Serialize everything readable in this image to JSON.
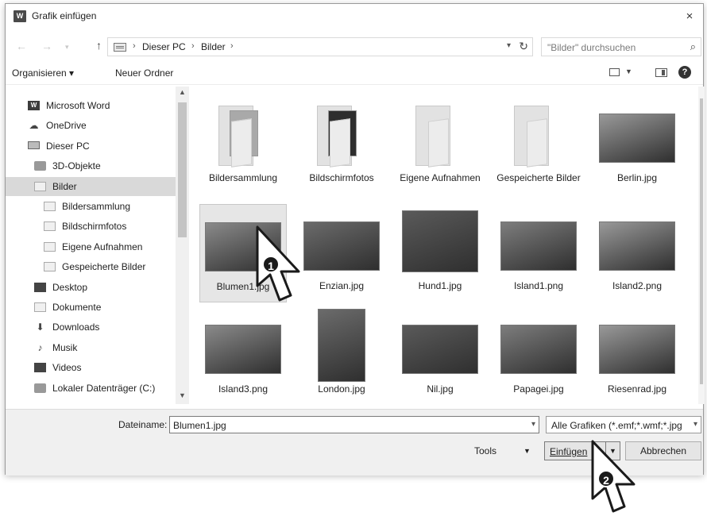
{
  "window": {
    "title": "Grafik einfügen",
    "app_icon_text": "W",
    "close_glyph": "×"
  },
  "nav": {
    "back": "←",
    "forward": "→",
    "up": "↑"
  },
  "address": {
    "crumbs": [
      "Dieser PC",
      "Bilder"
    ],
    "separator": "›"
  },
  "search": {
    "placeholder": "\"Bilder\" durchsuchen",
    "icon": "search-icon"
  },
  "toolbar": {
    "organize": "Organisieren ▾",
    "new_folder": "Neuer Ordner",
    "help": "?"
  },
  "sidebar": {
    "items": [
      {
        "label": "Microsoft Word",
        "icon": "word-icon"
      },
      {
        "label": "OneDrive",
        "icon": "cloud-icon"
      },
      {
        "label": "Dieser PC",
        "icon": "pc-icon"
      },
      {
        "label": "3D-Objekte",
        "icon": "cube-icon"
      },
      {
        "label": "Bilder",
        "icon": "pictures-icon",
        "selected": true
      },
      {
        "label": "Bildersammlung",
        "icon": "folder-icon"
      },
      {
        "label": "Bildschirmfotos",
        "icon": "folder-icon"
      },
      {
        "label": "Eigene Aufnahmen",
        "icon": "folder-icon"
      },
      {
        "label": "Gespeicherte Bilder",
        "icon": "folder-icon"
      },
      {
        "label": "Desktop",
        "icon": "desktop-icon"
      },
      {
        "label": "Dokumente",
        "icon": "document-icon"
      },
      {
        "label": "Downloads",
        "icon": "download-icon"
      },
      {
        "label": "Musik",
        "icon": "music-icon"
      },
      {
        "label": "Videos",
        "icon": "video-icon"
      },
      {
        "label": "Lokaler Datenträger (C:)",
        "icon": "drive-icon"
      }
    ]
  },
  "files": [
    {
      "label": "Bildersammlung",
      "kind": "folder-photos"
    },
    {
      "label": "Bildschirmfotos",
      "kind": "folder-dark"
    },
    {
      "label": "Eigene Aufnahmen",
      "kind": "folder"
    },
    {
      "label": "Gespeicherte Bilder",
      "kind": "folder"
    },
    {
      "label": "Berlin.jpg",
      "kind": "image"
    },
    {
      "label": "Blumen1.jpg",
      "kind": "image",
      "selected": true
    },
    {
      "label": "Enzian.jpg",
      "kind": "image"
    },
    {
      "label": "Hund1.jpg",
      "kind": "image"
    },
    {
      "label": "Island1.png",
      "kind": "image"
    },
    {
      "label": "Island2.png",
      "kind": "image"
    },
    {
      "label": "Island3.png",
      "kind": "image"
    },
    {
      "label": "London.jpg",
      "kind": "image"
    },
    {
      "label": "Nil.jpg",
      "kind": "image"
    },
    {
      "label": "Papagei.jpg",
      "kind": "image"
    },
    {
      "label": "Riesenrad.jpg",
      "kind": "image"
    }
  ],
  "bottom": {
    "filename_label": "Dateiname:",
    "filename_value": "Blumen1.jpg",
    "filter_value": "Alle Grafiken (*.emf;*.wmf;*.jpg",
    "tools": "Tools",
    "insert": "Einfügen",
    "cancel": "Abbrechen"
  },
  "callouts": [
    "1",
    "2"
  ]
}
